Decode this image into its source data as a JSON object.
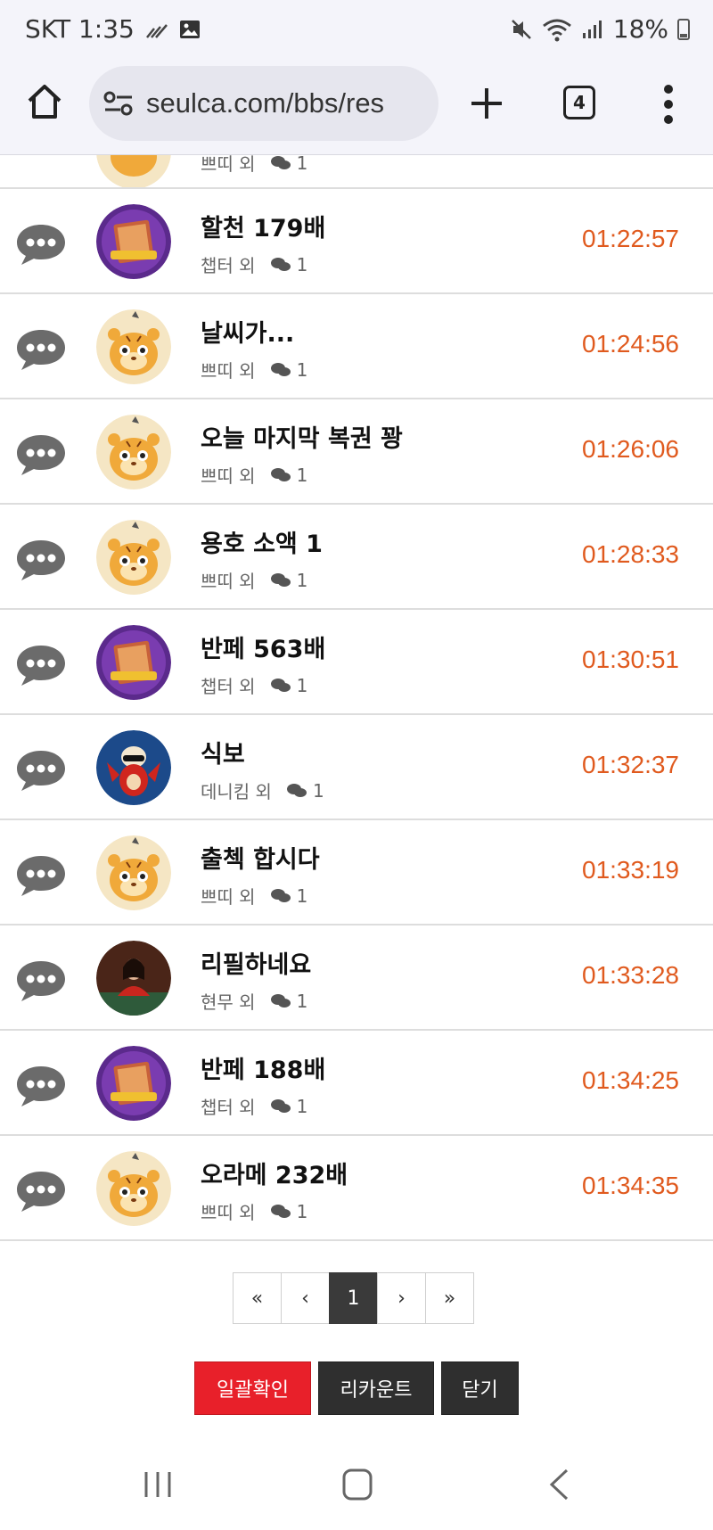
{
  "status_bar": {
    "carrier_time": "SKT 1:35",
    "battery": "18%"
  },
  "browser": {
    "url": "seulca.com/bbs/res",
    "tab_count": "4"
  },
  "list": {
    "partial_top_row": {
      "author": "쁘띠 외",
      "count": "1"
    },
    "rows": [
      {
        "title": "할천 179배",
        "author": "챕터 외",
        "count": "1",
        "time": "01:22:57",
        "avatar": "merlin"
      },
      {
        "title": "날씨가...",
        "author": "쁘띠 외",
        "count": "1",
        "time": "01:24:56",
        "avatar": "tiger"
      },
      {
        "title": "오늘 마지막 복권 꽝",
        "author": "쁘띠 외",
        "count": "1",
        "time": "01:26:06",
        "avatar": "tiger"
      },
      {
        "title": "용호 소액 1",
        "author": "쁘띠 외",
        "count": "1",
        "time": "01:28:33",
        "avatar": "tiger"
      },
      {
        "title": "반페 563배",
        "author": "챕터 외",
        "count": "1",
        "time": "01:30:51",
        "avatar": "merlin"
      },
      {
        "title": "식보",
        "author": "데니킴 외",
        "count": "1",
        "time": "01:32:37",
        "avatar": "bird"
      },
      {
        "title": "출첵 합시다",
        "author": "쁘띠 외",
        "count": "1",
        "time": "01:33:19",
        "avatar": "tiger"
      },
      {
        "title": "리필하네요",
        "author": "현무 외",
        "count": "1",
        "time": "01:33:28",
        "avatar": "dealer"
      },
      {
        "title": "반페 188배",
        "author": "챕터 외",
        "count": "1",
        "time": "01:34:25",
        "avatar": "merlin"
      },
      {
        "title": "오라메 232배",
        "author": "쁘띠 외",
        "count": "1",
        "time": "01:34:35",
        "avatar": "tiger"
      }
    ]
  },
  "pagination": {
    "first": "«",
    "prev": "‹",
    "current": "1",
    "next": "›",
    "last": "»"
  },
  "actions": {
    "confirm_all": "일괄확인",
    "recount": "리카운트",
    "close": "닫기"
  },
  "colors": {
    "time": "#e05a1e",
    "confirm_button": "#e8202a",
    "dark_button": "#2f2f2f"
  }
}
